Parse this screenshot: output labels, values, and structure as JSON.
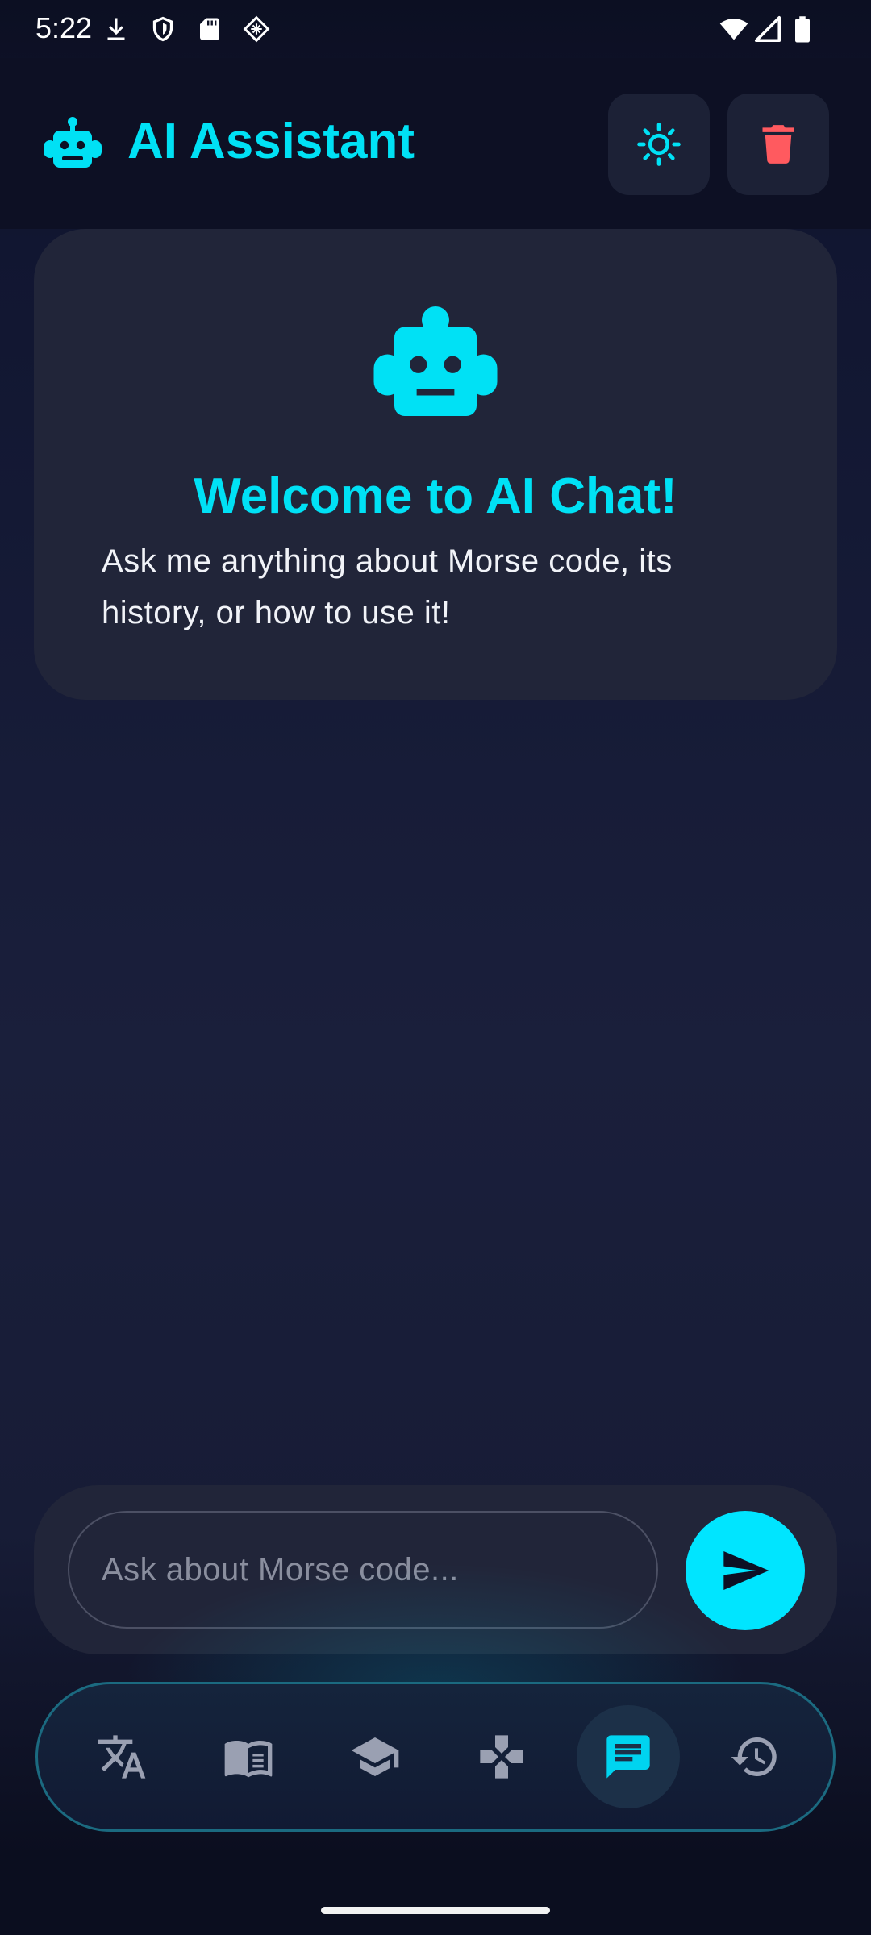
{
  "status_bar": {
    "time": "5:22",
    "left_icons": [
      "download-icon",
      "shield-icon",
      "sd-card-icon",
      "diamond-grid-icon"
    ],
    "right_icons": [
      "wifi-icon",
      "signal-icon",
      "battery-icon"
    ]
  },
  "app_bar": {
    "title": "AI Assistant",
    "logo_icon": "robot-icon",
    "theme_button_icon": "sun-icon",
    "clear_button_icon": "trash-icon",
    "accent_color": "#00e1f5",
    "danger_color": "#ff5a5f"
  },
  "welcome": {
    "icon": "robot-icon",
    "title": "Welcome to AI Chat!",
    "body": "Ask me anything about Morse code, its history, or how to use it!"
  },
  "composer": {
    "placeholder": "Ask about Morse code...",
    "value": "",
    "send_icon": "send-icon"
  },
  "bottom_nav": {
    "items": [
      {
        "id": "translate",
        "icon": "translate-icon",
        "active": false
      },
      {
        "id": "reference",
        "icon": "book-icon",
        "active": false
      },
      {
        "id": "learn",
        "icon": "graduation-cap-icon",
        "active": false
      },
      {
        "id": "games",
        "icon": "gamepad-icon",
        "active": false
      },
      {
        "id": "chat",
        "icon": "chat-icon",
        "active": true
      },
      {
        "id": "history",
        "icon": "history-icon",
        "active": false
      }
    ],
    "active_color": "#00d4f0",
    "inactive_color": "#9aa0b2"
  }
}
